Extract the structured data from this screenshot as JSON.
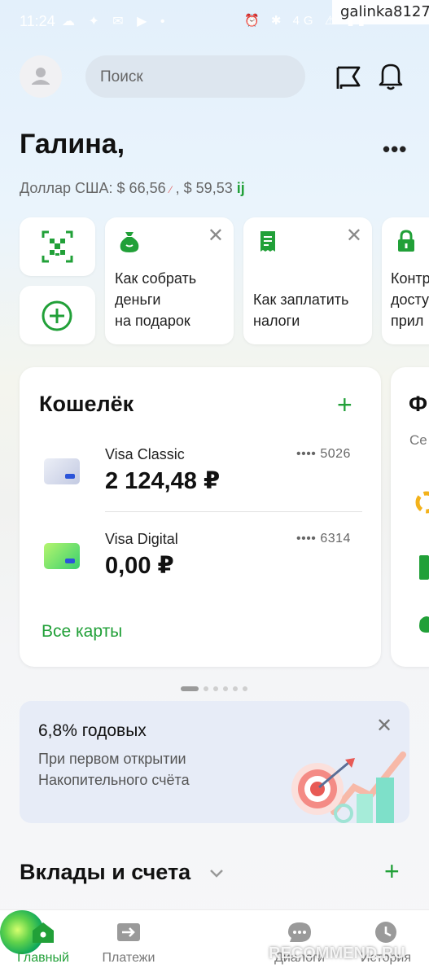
{
  "status_bar": {
    "time": "11:24",
    "left_icons": "☁ ✦ ✉ ▶ •",
    "right_icons": "⏰ ✱ 4G ⚠ ▮▮"
  },
  "watermark_user": "galinka8127",
  "header": {
    "search_placeholder": "Поиск",
    "greeting": "Галина,",
    "currency_label": "Доллар США: $ 66,56",
    "currency_second": ", $ 59,53"
  },
  "stories": [
    {
      "title": "Как собрать\nденьги\nна подарок"
    },
    {
      "title": "Как заплатить\nналоги"
    },
    {
      "title": "Контр\nдосту\nприл"
    }
  ],
  "wallet": {
    "title": "Кошелёк",
    "cards": [
      {
        "name": "Visa Classic",
        "amount": "2 124,48 ₽",
        "number": "•••• 5026"
      },
      {
        "name": "Visa Digital",
        "amount": "0,00 ₽",
        "number": "•••• 6314"
      }
    ],
    "all_cards_label": "Все карты"
  },
  "wallet2": {
    "title": "Ф",
    "subtitle": "Се"
  },
  "promo": {
    "title": "6,8% годовых",
    "text": "При первом открытии\nНакопительного счёта"
  },
  "deposits": {
    "title": "Вклады и счета"
  },
  "bottom_nav": [
    {
      "label": "Главный"
    },
    {
      "label": "Платежи"
    },
    {
      "label": "Диалоги"
    },
    {
      "label": "История"
    }
  ],
  "recommend_watermark": "RECOMMEND.RU",
  "colors": {
    "accent": "#21a038",
    "background": "#eaf4fc"
  }
}
